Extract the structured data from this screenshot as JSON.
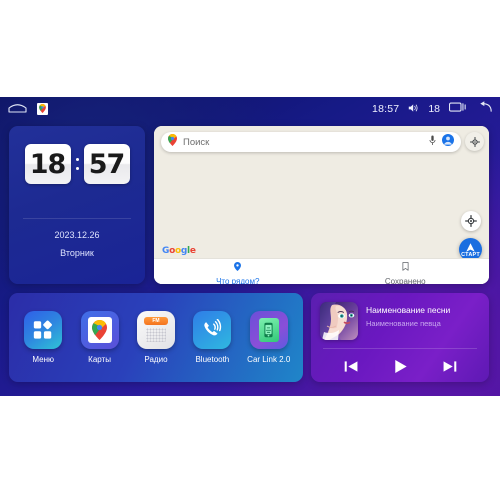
{
  "statusbar": {
    "home_icon": "home-icon",
    "app_icon": "google-maps-mini-icon",
    "time": "18:57",
    "volume_icon": "volume-icon",
    "volume_level": "18",
    "recents_icon": "recents-icon",
    "back_icon": "back-arrow-icon"
  },
  "clock_widget": {
    "hours": "18",
    "minutes": "57",
    "date": "2023.12.26",
    "weekday": "Вторник"
  },
  "map_widget": {
    "search": {
      "placeholder": "Поиск",
      "value": "",
      "pin_icon": "map-pin-icon",
      "mic_icon": "microphone-icon",
      "avatar_icon": "account-avatar-icon"
    },
    "layers_icon": "map-layers-icon",
    "compass_icon": "compass-icon",
    "start_button": {
      "label": "СТАРТ",
      "icon": "navigation-arrow-icon",
      "color": "#1a6ee0"
    },
    "attribution": "Google",
    "bottom_nav": [
      {
        "label": "Что рядом?",
        "icon": "map-pin-icon",
        "active": true,
        "color": "#1a73e8"
      },
      {
        "label": "Сохранено",
        "icon": "bookmark-icon",
        "active": false,
        "color": "#5f6368"
      }
    ]
  },
  "dock": {
    "apps": [
      {
        "label": "Меню",
        "icon": "apps-grid-icon"
      },
      {
        "label": "Карты",
        "icon": "google-maps-icon"
      },
      {
        "label": "Радио",
        "icon": "radio-icon",
        "display": "FM"
      },
      {
        "label": "Bluetooth",
        "icon": "bluetooth-phone-icon"
      },
      {
        "label": "Car Link 2.0",
        "icon": "car-link-icon"
      }
    ]
  },
  "music": {
    "album_art": "album-art-portrait",
    "title": "Наименование песни",
    "artist": "Наименование певца",
    "controls": [
      {
        "name": "previous-track-button",
        "icon": "skip-previous-icon"
      },
      {
        "name": "play-button",
        "icon": "play-icon"
      },
      {
        "name": "next-track-button",
        "icon": "skip-next-icon"
      }
    ]
  },
  "colors": {
    "accent_blue": "#1a73e8",
    "start_blue": "#1a6ee0",
    "music_purple": "#6a18c0",
    "map_bg": "#efece3"
  }
}
